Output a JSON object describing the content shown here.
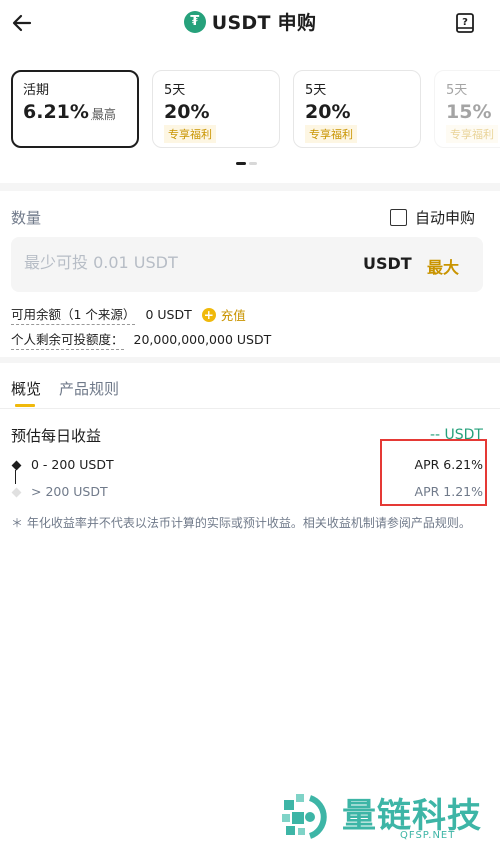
{
  "header": {
    "title": "USDT 申购",
    "logo_glyph": "₮",
    "back_icon": "arrow-left-icon",
    "help_icon": "book-icon"
  },
  "products": [
    {
      "term": "活期",
      "rate": "6.21%",
      "rate_sub": "最高",
      "tag": "",
      "selected": true
    },
    {
      "term": "5天",
      "rate": "20%",
      "rate_sub": "",
      "tag": "专享福利",
      "selected": false
    },
    {
      "term": "5天",
      "rate": "20%",
      "rate_sub": "",
      "tag": "专享福利",
      "selected": false
    },
    {
      "term": "5天",
      "rate": "15%",
      "rate_sub": "",
      "tag": "专享福利",
      "selected": false
    }
  ],
  "form": {
    "quantity_label": "数量",
    "auto_subscribe_label": "自动申购",
    "auto_subscribe_checked": false,
    "amount_placeholder": "最少可投 0.01 USDT",
    "amount_unit": "USDT",
    "max_label": "最大"
  },
  "balance": {
    "available_label": "可用余额（1 个来源）",
    "available_value": "0 USDT",
    "recharge_label": "充值",
    "remaining_label": "个人剩余可投额度：",
    "remaining_value": "20,000,000,000 USDT"
  },
  "tabs": [
    {
      "label": "概览",
      "active": true
    },
    {
      "label": "产品规则",
      "active": false
    }
  ],
  "estimate": {
    "label": "预估每日收益",
    "value": "-- USDT"
  },
  "tiers": [
    {
      "range": "0 - 200 USDT",
      "apr": "APR 6.21%",
      "active": true
    },
    {
      "range": "> 200 USDT",
      "apr": "APR 1.21%",
      "active": false
    }
  ],
  "note": "＊ 年化收益率并不代表以法币计算的实际或预计收益。相关收益机制请参阅产品规则。",
  "watermark": {
    "title": "量链科技",
    "subtitle": "QFSP.NET"
  },
  "colors": {
    "accent": "#f0b90b",
    "accent_text": "#c99400",
    "usdt_green": "#26a17b",
    "highlight_red": "#e53935",
    "muted": "#707a8a"
  }
}
